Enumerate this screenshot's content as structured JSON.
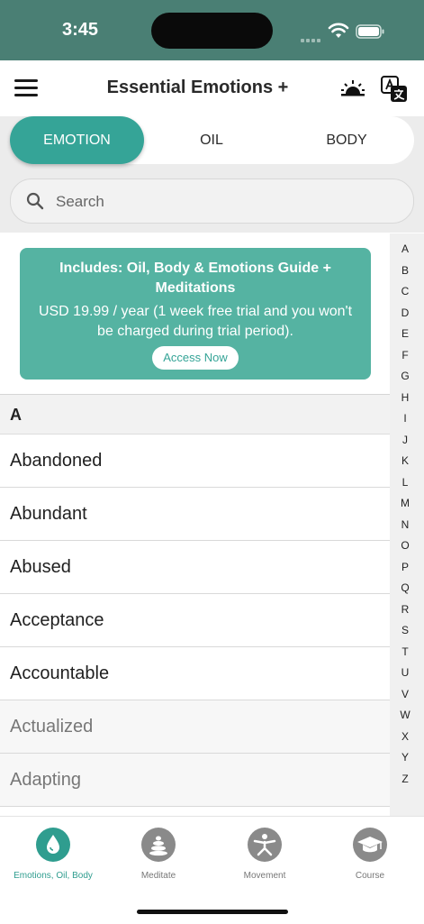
{
  "status_bar": {
    "time": "3:45"
  },
  "header": {
    "title": "Essential Emotions +",
    "menu_icon": "hamburger-menu-icon",
    "theme_icon": "sunset-icon",
    "translate_icon": "translate-icon"
  },
  "tabs": [
    {
      "label": "EMOTION",
      "active": true
    },
    {
      "label": "OIL",
      "active": false
    },
    {
      "label": "BODY",
      "active": false
    }
  ],
  "search": {
    "placeholder": "Search"
  },
  "promo": {
    "title": "Includes: Oil, Body & Emotions Guide + Meditations",
    "price": "USD 19.99 / year (1 week free trial and you won't be charged during trial period).",
    "button": "Access Now"
  },
  "list": {
    "section": "A",
    "items": [
      {
        "label": "Abandoned",
        "muted": false
      },
      {
        "label": "Abundant",
        "muted": false
      },
      {
        "label": "Abused",
        "muted": false
      },
      {
        "label": "Acceptance",
        "muted": false
      },
      {
        "label": "Accountable",
        "muted": false
      },
      {
        "label": "Actualized",
        "muted": true
      },
      {
        "label": "Adapting",
        "muted": true
      }
    ]
  },
  "index_letters": [
    "A",
    "B",
    "C",
    "D",
    "E",
    "F",
    "G",
    "H",
    "I",
    "J",
    "K",
    "L",
    "M",
    "N",
    "O",
    "P",
    "Q",
    "R",
    "S",
    "T",
    "U",
    "V",
    "W",
    "X",
    "Y",
    "Z"
  ],
  "tabbar": [
    {
      "label": "Emotions, Oil, Body",
      "icon": "drop-icon",
      "active": true
    },
    {
      "label": "Meditate",
      "icon": "stones-icon",
      "active": false
    },
    {
      "label": "Movement",
      "icon": "yoga-icon",
      "active": false
    },
    {
      "label": "Course",
      "icon": "graduation-cap-icon",
      "active": false
    }
  ],
  "colors": {
    "accent": "#35a497",
    "status_bar": "#4a7f74",
    "promo": "#55b3a2"
  }
}
